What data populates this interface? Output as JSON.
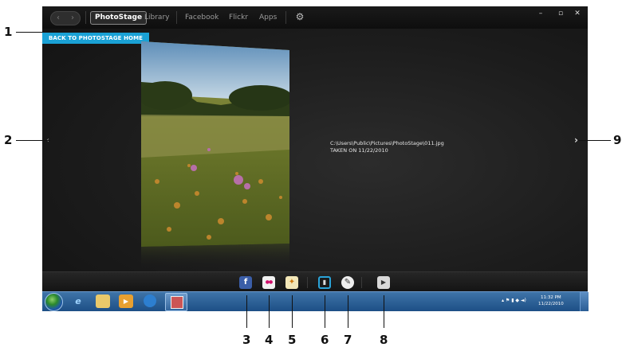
{
  "window": {
    "nav_back": "‹",
    "nav_forward": "›",
    "tabs": [
      "PhotoStage",
      "Library",
      "Facebook",
      "Flickr",
      "Apps"
    ],
    "active_tab": "PhotoStage",
    "controls": {
      "minimize": "–",
      "maximize": "▫",
      "close": "✕"
    }
  },
  "back_home_label": "BACK TO PHOTOSTAGE HOME",
  "photo": {
    "path": "C:\\Users\\Public\\Pictures\\PhotoStage\\011.jpg",
    "taken": "TAKEN ON 11/22/2010"
  },
  "arrows": {
    "previous": "‹",
    "next": "›"
  },
  "toolbar": {
    "facebook": "f",
    "flickr": "●●",
    "app_icon": "✦",
    "info_icon": "▮",
    "edit_icon": "✎",
    "play_icon": "▶"
  },
  "taskbar": {
    "clock_time": "11:32 PM",
    "clock_date": "11/22/2010",
    "tray_text": "▴  ⚑  ▮  ◆  ◄)"
  },
  "callouts": [
    "1",
    "2",
    "3",
    "4",
    "5",
    "6",
    "7",
    "8",
    "9"
  ],
  "colors": {
    "accent": "#1aa1d5",
    "window_bg": "#1c1c1c",
    "taskbar": "#2a5d95"
  }
}
